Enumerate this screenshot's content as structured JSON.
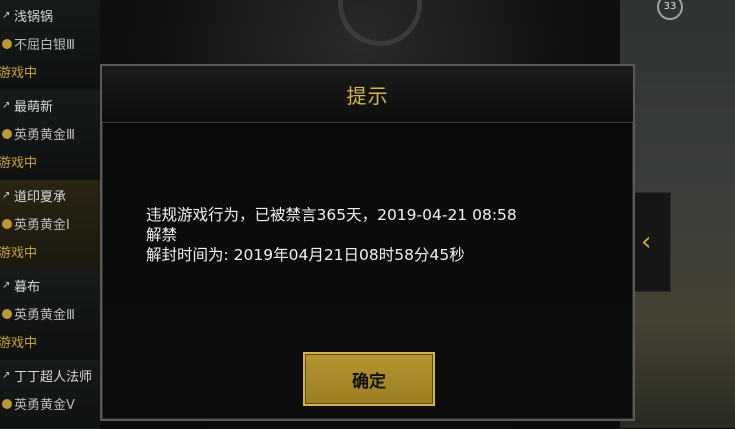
{
  "friends": [
    {
      "name": "浅锅锅",
      "rank": "不屈白银Ⅲ",
      "status": "游戏中"
    },
    {
      "name": "最萌新",
      "rank": "英勇黄金Ⅲ",
      "status": "游戏中"
    },
    {
      "name": "道印夏承",
      "rank": "英勇黄金Ⅰ",
      "status": "游戏中"
    },
    {
      "name": "暮布",
      "rank": "英勇黄金Ⅲ",
      "status": "游戏中"
    },
    {
      "name": "丁丁超人法师",
      "rank": "英勇黄金Ⅴ",
      "status": ""
    }
  ],
  "level_badge": "33",
  "dialog": {
    "title": "提示",
    "message_line1": "违规游戏行为，已被禁言365天，2019-04-21 08:58",
    "message_line2": "解禁",
    "message_line3": "解封时间为: 2019年04月21日08时58分45秒",
    "confirm_label": "确定"
  },
  "colors": {
    "accent_gold": "#d4b64a",
    "button_gold": "#b4952f",
    "status_gold": "#c7a536"
  },
  "icons": {
    "friend_arrow": "arrow-icon",
    "rank": "rank-icon",
    "side_nav": "chevron-left-icon"
  }
}
